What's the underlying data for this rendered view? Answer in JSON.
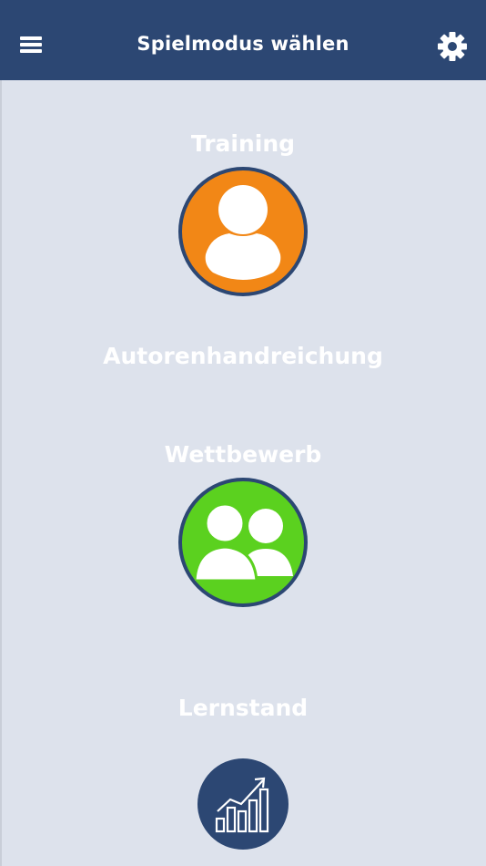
{
  "header": {
    "title": "Spielmodus wählen",
    "menu_icon": "hamburger-menu-icon",
    "settings_icon": "gear-icon"
  },
  "modes": [
    {
      "label": "Training",
      "icon": "person-icon",
      "color": "#f28716"
    },
    {
      "label": "Autorenhandreichung"
    },
    {
      "label": "Wettbewerb",
      "icon": "group-icon",
      "color": "#5bd11f"
    },
    {
      "label": "Lernstand",
      "icon": "growth-chart-icon",
      "color": "#2c4773"
    }
  ],
  "colors": {
    "header_bg": "#2c4773",
    "page_bg": "#dde2ec",
    "ring": "#2c4773"
  }
}
